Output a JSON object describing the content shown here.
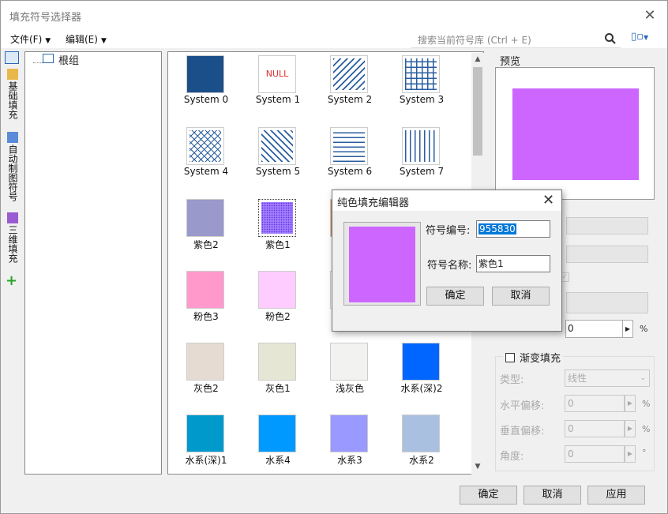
{
  "window": {
    "title": "填充符号选择器"
  },
  "menu": {
    "file": "文件(F)",
    "edit": "编辑(E)"
  },
  "search": {
    "placeholder": "搜索当前符号库 (Ctrl + E)"
  },
  "left_tabs": [
    {
      "label": "基础填充"
    },
    {
      "label": "自动制图符号"
    },
    {
      "label": "三维填充"
    }
  ],
  "tree": {
    "root": "根组"
  },
  "symbols": [
    {
      "label": "System 0",
      "color": "#1b4f8a",
      "pattern": "solid"
    },
    {
      "label": "System 1",
      "color": "#ffffff",
      "pattern": "null",
      "text": "NULL"
    },
    {
      "label": "System 2",
      "color": "#2a5ea0",
      "pattern": "diag"
    },
    {
      "label": "System 3",
      "color": "#2a5ea0",
      "pattern": "grid"
    },
    {
      "label": "System 4",
      "color": "#2a5ea0",
      "pattern": "cross"
    },
    {
      "label": "System 5",
      "color": "#2a5ea0",
      "pattern": "diag-rev"
    },
    {
      "label": "System 6",
      "color": "#2a5ea0",
      "pattern": "hlines"
    },
    {
      "label": "System 7",
      "color": "#2a5ea0",
      "pattern": "vlines"
    },
    {
      "label": "紫色2",
      "color": "#9999cc",
      "pattern": "solid"
    },
    {
      "label": "紫色1",
      "color": "#8855ee",
      "pattern": "dots",
      "selected": true
    },
    {
      "label": "",
      "color": "#cc8855",
      "pattern": "solid"
    },
    {
      "label": "",
      "color": "#ffffff",
      "pattern": "solid"
    },
    {
      "label": "粉色3",
      "color": "#ff99cc",
      "pattern": "solid"
    },
    {
      "label": "粉色2",
      "color": "#ffccff",
      "pattern": "solid"
    },
    {
      "label": "",
      "color": "#ffffff",
      "pattern": "solid"
    },
    {
      "label": "",
      "color": "#ffffff",
      "pattern": "solid"
    },
    {
      "label": "灰色2",
      "color": "#e6dbd2",
      "pattern": "solid"
    },
    {
      "label": "灰色1",
      "color": "#e6e6d4",
      "pattern": "solid"
    },
    {
      "label": "浅灰色",
      "color": "#f2f2f0",
      "pattern": "solid"
    },
    {
      "label": "水系(深)2",
      "color": "#0066ff",
      "pattern": "solid"
    },
    {
      "label": "水系(深)1",
      "color": "#0099cc",
      "pattern": "solid"
    },
    {
      "label": "水系4",
      "color": "#0099ff",
      "pattern": "solid"
    },
    {
      "label": "水系3",
      "color": "#9999ff",
      "pattern": "solid"
    },
    {
      "label": "水系2",
      "color": "#aac0e0",
      "pattern": "solid"
    }
  ],
  "preview": {
    "label": "预览",
    "color": "#cc66ff"
  },
  "panel": {
    "transparency": "0",
    "transparency_unit": "%",
    "gradient_label": "渐变填充",
    "type_label": "类型:",
    "type_value": "线性",
    "h_offset_label": "水平偏移:",
    "h_offset_value": "0",
    "h_offset_unit": "%",
    "v_offset_label": "垂直偏移:",
    "v_offset_value": "0",
    "v_offset_unit": "%",
    "angle_label": "角度:",
    "angle_value": "0",
    "angle_unit": "°"
  },
  "buttons": {
    "ok": "确定",
    "cancel": "取消",
    "apply": "应用"
  },
  "dialog": {
    "title": "纯色填充编辑器",
    "color": "#cc66ff",
    "no_label": "符号编号:",
    "no_value": "955830",
    "name_label": "符号名称:",
    "name_value": "紫色1",
    "ok": "确定",
    "cancel": "取消"
  }
}
